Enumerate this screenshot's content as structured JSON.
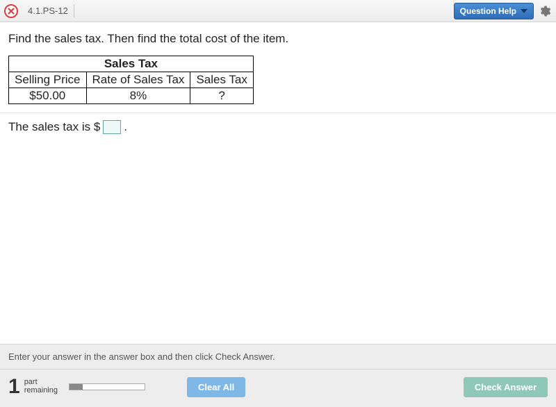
{
  "header": {
    "question_id": "4.1.PS-12",
    "help_label": "Question Help"
  },
  "question": {
    "prompt": "Find the sales tax. Then find the total cost of the item.",
    "table": {
      "title": "Sales Tax",
      "headers": [
        "Selling Price",
        "Rate of Sales Tax",
        "Sales Tax"
      ],
      "row": [
        "$50.00",
        "8%",
        "?"
      ]
    },
    "answer_prefix": "The sales tax is $",
    "answer_value": "",
    "answer_suffix": "."
  },
  "footer": {
    "instruction": "Enter your answer in the answer box and then click Check Answer.",
    "parts_count": "1",
    "parts_label_line1": "part",
    "parts_label_line2": "remaining",
    "clear_label": "Clear All",
    "check_label": "Check Answer"
  }
}
